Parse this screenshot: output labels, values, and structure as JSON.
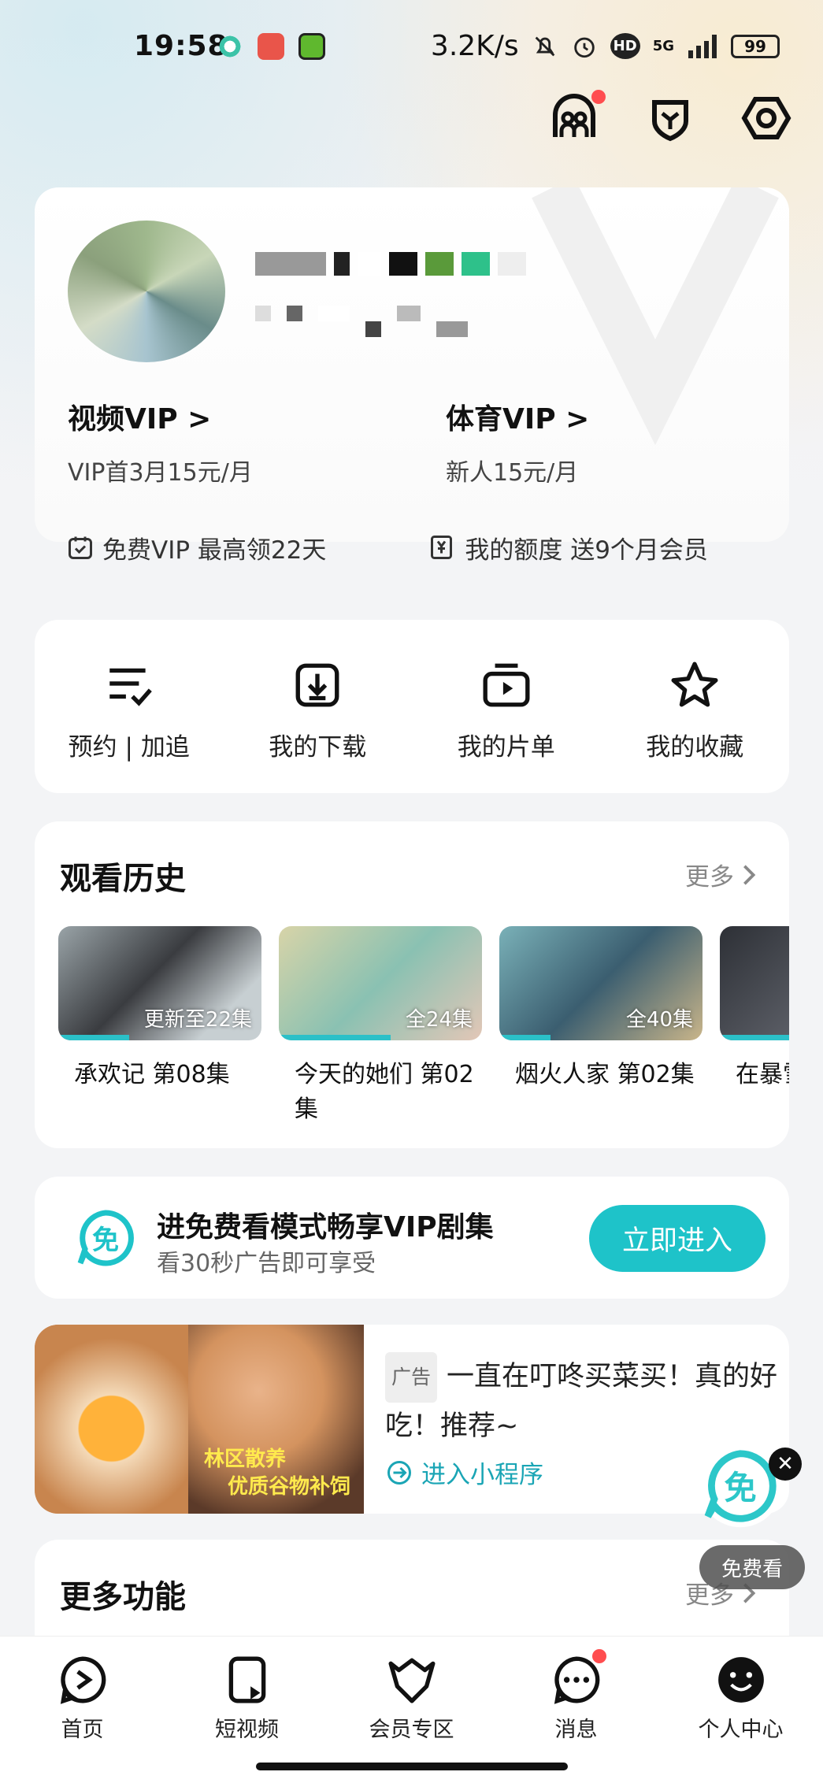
{
  "status": {
    "time": "19:58",
    "speed": "3.2K/s",
    "network": "5G",
    "battery": "99"
  },
  "header_icons": [
    "community-icon",
    "shield-icon",
    "settings-icon"
  ],
  "vip": {
    "video_title": "视频VIP >",
    "video_sub": "VIP首3月15元/月",
    "sports_title": "体育VIP >",
    "sports_sub": "新人15元/月",
    "free_vip": "免费VIP 最高领22天",
    "quota": "我的额度 送9个月会员"
  },
  "quick": [
    {
      "label": "预约 | 加追",
      "icon": "reserve-list-icon"
    },
    {
      "label": "我的下载",
      "icon": "download-icon"
    },
    {
      "label": "我的片单",
      "icon": "playlist-icon"
    },
    {
      "label": "我的收藏",
      "icon": "star-icon"
    }
  ],
  "history": {
    "title": "观看历史",
    "more": "更多",
    "items": [
      {
        "label": "更新至22集",
        "title": "承欢记 第08集",
        "progress": 0.35
      },
      {
        "label": "全24集",
        "title": "今天的她们 第02集",
        "progress": 0.55
      },
      {
        "label": "全40集",
        "title": "烟火人家 第02集",
        "progress": 0.25
      },
      {
        "label": "",
        "title": "在暴雪集",
        "progress": 0.6
      }
    ]
  },
  "free": {
    "title": "进免费看模式畅享VIP剧集",
    "sub": "看30秒广告即可享受",
    "button": "立即进入"
  },
  "ad": {
    "tag": "广告",
    "text": "一直在叮咚买菜买！真的好吃！推荐~",
    "link": "进入小程序",
    "img_text1": "林区散养",
    "img_text2": "优质谷物补饲"
  },
  "more_func": {
    "title": "更多功能",
    "more": "更多"
  },
  "float": {
    "label": "免费看"
  },
  "tabs": [
    {
      "label": "首页",
      "icon": "home-play-icon"
    },
    {
      "label": "短视频",
      "icon": "short-video-icon"
    },
    {
      "label": "会员专区",
      "icon": "vip-crown-icon"
    },
    {
      "label": "消息",
      "icon": "message-icon"
    },
    {
      "label": "个人中心",
      "icon": "profile-icon"
    }
  ]
}
